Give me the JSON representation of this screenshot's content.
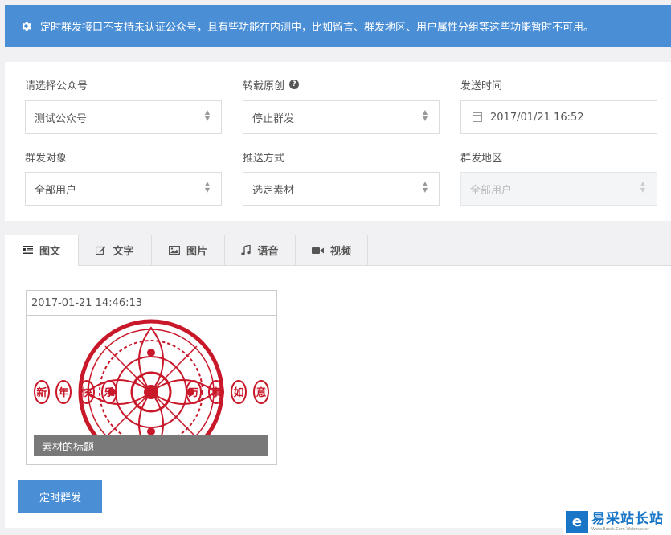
{
  "notice": {
    "icon": "gear-icon",
    "text": "定时群发接口不支持未认证公众号，且有些功能在内测中，比如留言、群发地区、用户属性分组等这些功能暂时不可用。"
  },
  "form": {
    "account": {
      "label": "请选择公众号",
      "value": "测试公众号"
    },
    "original": {
      "label": "转载原创",
      "help_icon": "question-circle-icon",
      "value": "停止群发"
    },
    "send_time": {
      "label": "发送时间",
      "icon": "calendar-icon",
      "value": "2017/01/21 16:52"
    },
    "target": {
      "label": "群发对象",
      "value": "全部用户"
    },
    "push_method": {
      "label": "推送方式",
      "value": "选定素材"
    },
    "region": {
      "label": "群发地区",
      "value": "全部用户",
      "disabled": true
    }
  },
  "tabs": [
    {
      "label": "图文",
      "icon": "news-icon",
      "active": true
    },
    {
      "label": "文字",
      "icon": "edit-icon",
      "active": false
    },
    {
      "label": "图片",
      "icon": "image-icon",
      "active": false
    },
    {
      "label": "语音",
      "icon": "music-icon",
      "active": false
    },
    {
      "label": "视频",
      "icon": "video-icon",
      "active": false
    }
  ],
  "material": {
    "date": "2017-01-21 14:46:13",
    "art_left_chars": [
      "新",
      "年",
      "快",
      "乐"
    ],
    "art_right_chars": [
      "万",
      "事",
      "如",
      "意"
    ],
    "caption": "素材的标题"
  },
  "submit_label": "定时群发",
  "watermark": {
    "logo_char": "e",
    "name": "易采站长站",
    "sub": "Www.Easck.Com Webmaster"
  },
  "colors": {
    "primary": "#4a8ed6",
    "art_red": "#c8182a",
    "caption_bg": "#7a797a"
  }
}
